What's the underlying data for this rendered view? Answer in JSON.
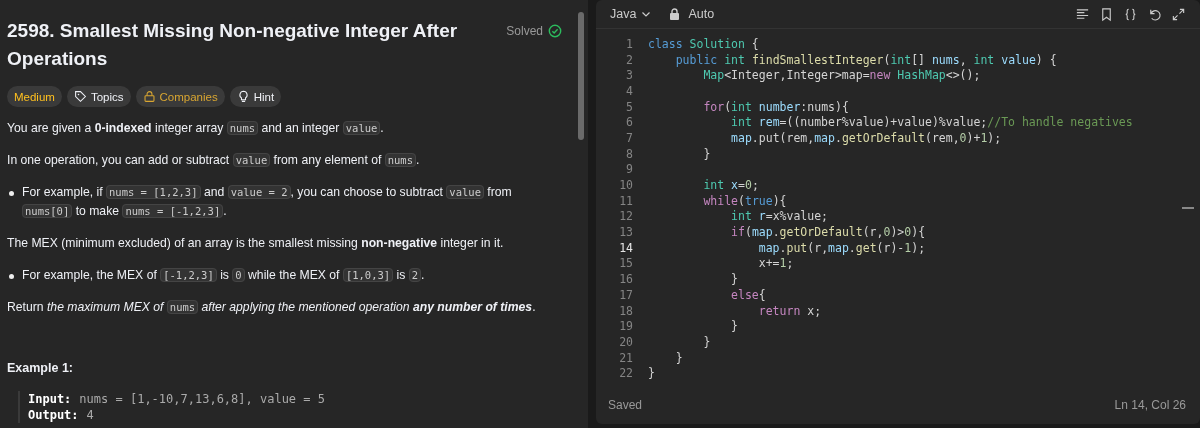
{
  "problem": {
    "title": "2598. Smallest Missing Non-negative Integer After Operations",
    "status": "Solved",
    "solved": true,
    "tags": [
      {
        "kind": "difficulty",
        "label": "Medium"
      },
      {
        "kind": "topics",
        "label": "Topics"
      },
      {
        "kind": "companies",
        "label": "Companies"
      },
      {
        "kind": "hint",
        "label": "Hint"
      }
    ],
    "blocks": [
      {
        "kind": "para",
        "parts": [
          {
            "kind": "text",
            "text": "You are given a **0-indexed** integer array "
          },
          {
            "kind": "code",
            "text": "nums"
          },
          {
            "kind": "text",
            "text": " and an integer "
          },
          {
            "kind": "code",
            "text": "value"
          },
          {
            "kind": "text",
            "text": "."
          }
        ]
      },
      {
        "kind": "para",
        "parts": [
          {
            "kind": "text",
            "text": "In one operation, you can add or subtract "
          },
          {
            "kind": "code",
            "text": "value"
          },
          {
            "kind": "text",
            "text": " from any element of "
          },
          {
            "kind": "code",
            "text": "nums"
          },
          {
            "kind": "text",
            "text": "."
          }
        ]
      },
      {
        "kind": "bullet",
        "parts": [
          {
            "kind": "text",
            "text": "For example, if "
          },
          {
            "kind": "code",
            "text": "nums = [1,2,3]"
          },
          {
            "kind": "text",
            "text": " and "
          },
          {
            "kind": "code",
            "text": "value = 2"
          },
          {
            "kind": "text",
            "text": ", you can choose to subtract "
          },
          {
            "kind": "code",
            "text": "value"
          },
          {
            "kind": "text",
            "text": " from "
          },
          {
            "kind": "code",
            "text": "nums[0]"
          },
          {
            "kind": "text",
            "text": " to make "
          },
          {
            "kind": "code",
            "text": "nums = [-1,2,3]"
          },
          {
            "kind": "text",
            "text": "."
          }
        ]
      },
      {
        "kind": "para",
        "parts": [
          {
            "kind": "text",
            "text": "The MEX (minimum excluded) of an array is the smallest missing **non-negative** integer in it."
          }
        ]
      },
      {
        "kind": "bullet",
        "parts": [
          {
            "kind": "text",
            "text": "For example, the MEX of "
          },
          {
            "kind": "code",
            "text": "[-1,2,3]"
          },
          {
            "kind": "text",
            "text": " is "
          },
          {
            "kind": "code",
            "text": "0"
          },
          {
            "kind": "text",
            "text": " while the MEX of "
          },
          {
            "kind": "code",
            "text": "[1,0,3]"
          },
          {
            "kind": "text",
            "text": " is "
          },
          {
            "kind": "code",
            "text": "2"
          },
          {
            "kind": "text",
            "text": "."
          }
        ]
      },
      {
        "kind": "para",
        "parts": [
          {
            "kind": "text",
            "text": "Return "
          },
          {
            "kind": "italic",
            "text": "the maximum MEX of "
          },
          {
            "kind": "code",
            "text": "nums"
          },
          {
            "kind": "italic",
            "text": " after applying the mentioned operation **any number of times**"
          },
          {
            "kind": "text",
            "text": "."
          }
        ]
      }
    ],
    "example": {
      "title": "Example 1:",
      "lines": [
        {
          "label": "Input:",
          "value": "nums = [1,-10,7,13,6,8], value = 5"
        },
        {
          "label": "Output:",
          "value": "4"
        }
      ]
    }
  },
  "editor": {
    "language": "Java",
    "mode": "Auto",
    "status": "Saved",
    "position": "Ln 14, Col 26",
    "lines": [
      {
        "number": "1",
        "active": false,
        "tokens": [
          {
            "kind": "keyword",
            "t": "class "
          },
          {
            "kind": "type",
            "t": "Solution"
          },
          {
            "kind": "plain",
            "t": " {"
          }
        ]
      },
      {
        "number": "2",
        "active": false,
        "tokens": [
          {
            "kind": "keyword",
            "t": "    public "
          },
          {
            "kind": "type",
            "t": "int "
          },
          {
            "kind": "function",
            "t": "findSmallestInteger"
          },
          {
            "kind": "plain",
            "t": "("
          },
          {
            "kind": "type",
            "t": "int"
          },
          {
            "kind": "plain",
            "t": "[] "
          },
          {
            "kind": "variable",
            "t": "nums"
          },
          {
            "kind": "plain",
            "t": ", "
          },
          {
            "kind": "type",
            "t": "int "
          },
          {
            "kind": "variable",
            "t": "value"
          },
          {
            "kind": "plain",
            "t": ") {"
          }
        ]
      },
      {
        "number": "3",
        "active": false,
        "tokens": [
          {
            "kind": "type",
            "t": "        Map"
          },
          {
            "kind": "plain",
            "t": "<Integer,Integer>map="
          },
          {
            "kind": "control",
            "t": "new "
          },
          {
            "kind": "type",
            "t": "HashMap"
          },
          {
            "kind": "plain",
            "t": "<>();"
          }
        ]
      },
      {
        "number": "4",
        "active": false
      },
      {
        "number": "5",
        "active": false,
        "tokens": [
          {
            "kind": "control",
            "t": "        for"
          },
          {
            "kind": "plain",
            "t": "("
          },
          {
            "kind": "type",
            "t": "int "
          },
          {
            "kind": "variable",
            "t": "number"
          },
          {
            "kind": "plain",
            "t": ":nums){"
          }
        ]
      },
      {
        "number": "6",
        "active": false,
        "tokens": [
          {
            "kind": "type",
            "t": "            int "
          },
          {
            "kind": "variable",
            "t": "rem"
          },
          {
            "kind": "plain",
            "t": "=((number%value)+value)%value;"
          },
          {
            "kind": "comment",
            "t": "//To handle negatives"
          }
        ]
      },
      {
        "number": "7",
        "active": false,
        "tokens": [
          {
            "kind": "variable",
            "t": "            map"
          },
          {
            "kind": "plain",
            "t": ".put(rem,"
          },
          {
            "kind": "variable",
            "t": "map"
          },
          {
            "kind": "plain",
            "t": "."
          },
          {
            "kind": "function",
            "t": "getOrDefault"
          },
          {
            "kind": "plain",
            "t": "(rem,"
          },
          {
            "kind": "number",
            "t": "0"
          },
          {
            "kind": "plain",
            "t": ")+"
          },
          {
            "kind": "number",
            "t": "1"
          },
          {
            "kind": "plain",
            "t": ");"
          }
        ]
      },
      {
        "number": "8",
        "active": false,
        "tokens": [
          {
            "kind": "plain",
            "t": "        }"
          }
        ]
      },
      {
        "number": "9",
        "active": false
      },
      {
        "number": "10",
        "active": false,
        "tokens": [
          {
            "kind": "type",
            "t": "        int "
          },
          {
            "kind": "variable",
            "t": "x"
          },
          {
            "kind": "plain",
            "t": "="
          },
          {
            "kind": "number",
            "t": "0"
          },
          {
            "kind": "plain",
            "t": ";"
          }
        ]
      },
      {
        "number": "11",
        "active": false,
        "tokens": [
          {
            "kind": "control",
            "t": "        while"
          },
          {
            "kind": "plain",
            "t": "("
          },
          {
            "kind": "keyword",
            "t": "true"
          },
          {
            "kind": "plain",
            "t": "){"
          }
        ]
      },
      {
        "number": "12",
        "active": false,
        "tokens": [
          {
            "kind": "type",
            "t": "            int "
          },
          {
            "kind": "variable",
            "t": "r"
          },
          {
            "kind": "plain",
            "t": "=x%value;"
          }
        ]
      },
      {
        "number": "13",
        "active": false,
        "tokens": [
          {
            "kind": "control",
            "t": "            if"
          },
          {
            "kind": "plain",
            "t": "("
          },
          {
            "kind": "variable",
            "t": "map"
          },
          {
            "kind": "plain",
            "t": "."
          },
          {
            "kind": "function",
            "t": "getOrDefault"
          },
          {
            "kind": "plain",
            "t": "(r,"
          },
          {
            "kind": "number",
            "t": "0"
          },
          {
            "kind": "plain",
            "t": ")>"
          },
          {
            "kind": "number",
            "t": "0"
          },
          {
            "kind": "plain",
            "t": "){"
          }
        ]
      },
      {
        "number": "14",
        "active": true,
        "tokens": [
          {
            "kind": "variable",
            "t": "                map"
          },
          {
            "kind": "plain",
            "t": "."
          },
          {
            "kind": "function",
            "t": "put"
          },
          {
            "kind": "plain",
            "t": "(r,"
          },
          {
            "kind": "variable",
            "t": "map"
          },
          {
            "kind": "plain",
            "t": "."
          },
          {
            "kind": "function",
            "t": "get"
          },
          {
            "kind": "plain",
            "t": "(r)-"
          },
          {
            "kind": "number",
            "t": "1"
          },
          {
            "kind": "plain",
            "t": ");"
          }
        ]
      },
      {
        "number": "15",
        "active": false,
        "tokens": [
          {
            "kind": "plain",
            "t": "                x+="
          },
          {
            "kind": "number",
            "t": "1"
          },
          {
            "kind": "plain",
            "t": ";"
          }
        ]
      },
      {
        "number": "16",
        "active": false,
        "tokens": [
          {
            "kind": "plain",
            "t": "            }"
          }
        ]
      },
      {
        "number": "17",
        "active": false,
        "tokens": [
          {
            "kind": "control",
            "t": "            else"
          },
          {
            "kind": "plain",
            "t": "{"
          }
        ]
      },
      {
        "number": "18",
        "active": false,
        "tokens": [
          {
            "kind": "control",
            "t": "                return "
          },
          {
            "kind": "plain",
            "t": "x;"
          }
        ]
      },
      {
        "number": "19",
        "active": false,
        "tokens": [
          {
            "kind": "plain",
            "t": "            }"
          }
        ]
      },
      {
        "number": "20",
        "active": false,
        "tokens": [
          {
            "kind": "plain",
            "t": "        }"
          }
        ]
      },
      {
        "number": "21",
        "active": false,
        "tokens": [
          {
            "kind": "plain",
            "t": "    }"
          }
        ]
      },
      {
        "number": "22",
        "active": false,
        "tokens": [
          {
            "kind": "plain",
            "t": "}"
          }
        ]
      }
    ]
  }
}
